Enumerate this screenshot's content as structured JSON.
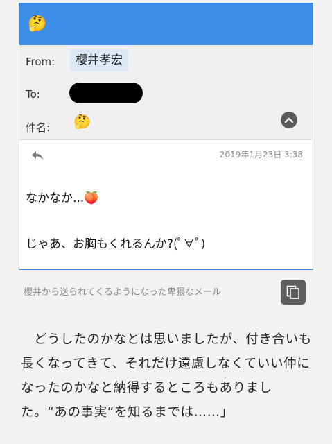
{
  "header": {
    "emoji": "🤔"
  },
  "meta": {
    "from_label": "From:",
    "from_value": "櫻井孝宏",
    "to_label": "To:",
    "subject_label": "件名:",
    "subject_emoji": "🤔"
  },
  "message": {
    "date": "2019年1月23日 3:38",
    "line1": "なかなか...🍑",
    "line2": "じゃあ、お胸もくれるんか?(ﾟ∀ﾟ)"
  },
  "caption": "櫻井から送られてくるようになった卑猥なメール",
  "paragraph": "　どうしたのかなとは思いましたが、付き合いも長くなってきて、それだけ遠慮しなくていい仲になったのかなと納得するところもありました。“あの事実“を知るまでは……」",
  "colors": {
    "accent": "#3d8ee8",
    "meta_bg": "#f0f0f0",
    "chip_bg": "#dce8f6"
  },
  "icons": [
    "thinking-emoji",
    "chevron-up-icon",
    "reply-icon",
    "copy-icon"
  ]
}
